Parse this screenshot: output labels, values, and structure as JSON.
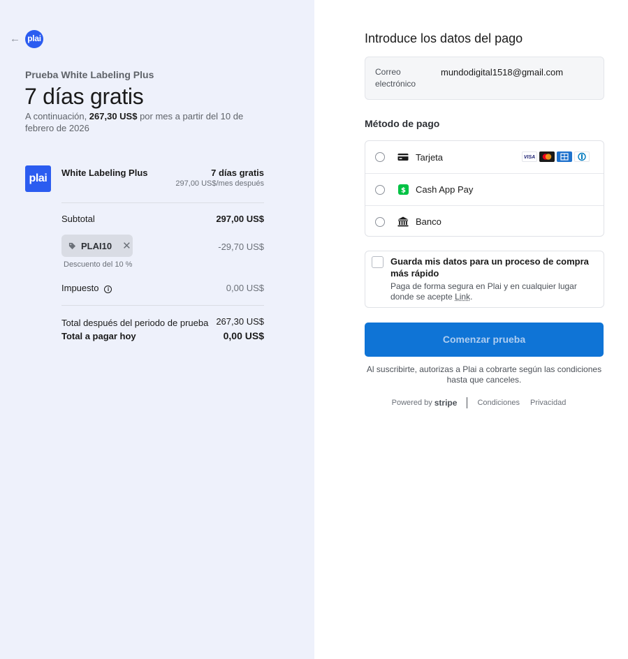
{
  "header": {
    "back_glyph": "←",
    "logo_text": "plai"
  },
  "summary": {
    "product_name": "Prueba White Labeling Plus",
    "title": "7 días gratis",
    "desc_prefix": "A continuación, ",
    "desc_amount": "267,30 US$",
    "desc_suffix": " por mes a partir del 10 de febrero de 2026"
  },
  "item": {
    "logo_text": "plai",
    "name": "White Labeling Plus",
    "price": "7 días gratis",
    "price_after": "297,00 US$/mes después"
  },
  "totals": {
    "subtotal_label": "Subtotal",
    "subtotal_value": "297,00 US$",
    "promo_code": "PLAI10",
    "promo_remove": "✕",
    "discount_value": "-29,70 US$",
    "discount_note": "Descuento del 10 %",
    "tax_label": "Impuesto",
    "tax_info": "i",
    "tax_value": "0,00 US$",
    "after_trial_label": "Total después del periodo de prueba",
    "after_trial_value": "267,30 US$",
    "today_label": "Total a pagar hoy",
    "today_value": "0,00 US$"
  },
  "payment": {
    "title": "Introduce los datos del pago",
    "email_label": "Correo electrónico",
    "email_value": "mundodigital1518@gmail.com",
    "method_title": "Método de pago",
    "methods": [
      {
        "label": "Tarjeta",
        "icon": "card-icon"
      },
      {
        "label": "Cash App Pay",
        "icon": "cashapp-icon"
      },
      {
        "label": "Banco",
        "icon": "bank-icon"
      }
    ],
    "brands": [
      "VISA",
      "mastercard",
      "amex",
      "diners"
    ],
    "save_title": "Guarda mis datos para un proceso de compra más rápido",
    "save_desc": "Paga de forma segura en Plai y en cualquier lugar donde se acepte ",
    "save_link": "Link",
    "save_desc_end": ".",
    "cta_label": "Comenzar prueba",
    "legal": "Al suscribirte, autorizas a Plai a cobrarte según las condiciones hasta que canceles.",
    "powered_by": "Powered by",
    "stripe": "stripe",
    "terms": "Condiciones",
    "privacy": "Privacidad"
  },
  "colors": {
    "left_bg": "#eef1fb",
    "brand_blue": "#2b5cf0",
    "cta_blue": "#0f74d6",
    "cashapp_green": "#00c244"
  }
}
